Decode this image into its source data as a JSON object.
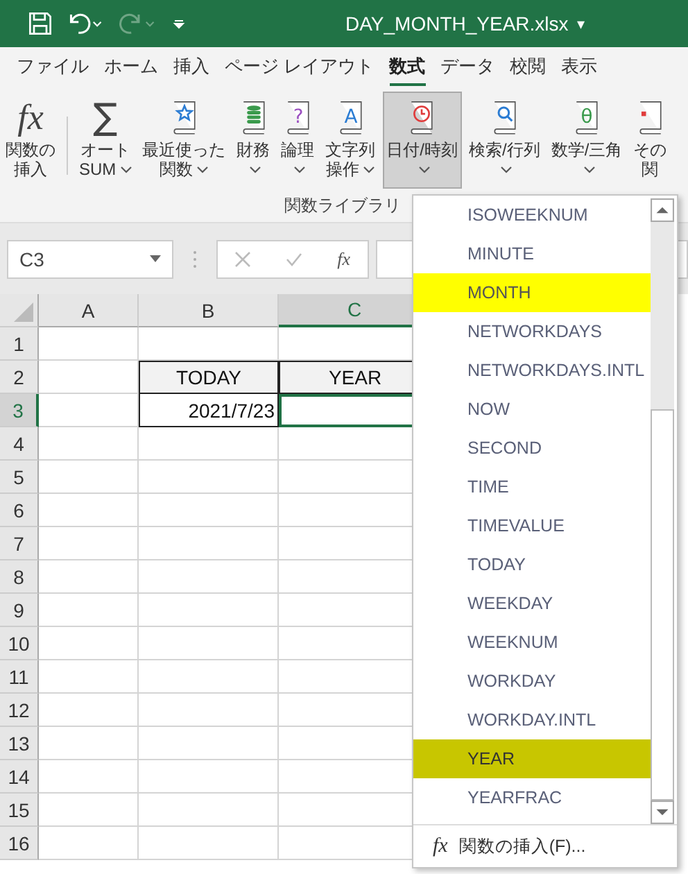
{
  "title_bar": {
    "filename": "DAY_MONTH_YEAR.xlsx",
    "caret": "▾"
  },
  "tabs": [
    {
      "label": "ファイル",
      "selected": false
    },
    {
      "label": "ホーム",
      "selected": false
    },
    {
      "label": "挿入",
      "selected": false
    },
    {
      "label": "ページ レイアウト",
      "selected": false
    },
    {
      "label": "数式",
      "selected": true
    },
    {
      "label": "データ",
      "selected": false
    },
    {
      "label": "校閲",
      "selected": false
    },
    {
      "label": "表示",
      "selected": false
    }
  ],
  "ribbon": {
    "buttons": [
      {
        "lines": [
          "関数の",
          "挿入"
        ],
        "dropdown": false,
        "pressed": false,
        "icon": {
          "kind": "glyph",
          "glyph": "fx"
        }
      },
      {
        "lines": [
          "オート",
          "SUM"
        ],
        "dropdown": true,
        "pressed": false,
        "icon": {
          "kind": "glyph",
          "glyph": "∑"
        }
      },
      {
        "lines": [
          "最近使った",
          "関数"
        ],
        "dropdown": true,
        "pressed": false,
        "icon": {
          "kind": "star",
          "color": "#2b7cd3"
        }
      },
      {
        "lines": [
          "財務"
        ],
        "dropdown": true,
        "pressed": false,
        "icon": {
          "kind": "database",
          "color": "#3a9a4c"
        }
      },
      {
        "lines": [
          "論理"
        ],
        "dropdown": true,
        "pressed": false,
        "icon": {
          "kind": "letter",
          "glyph": "?",
          "color": "#9b4fc0"
        }
      },
      {
        "lines": [
          "文字列",
          "操作"
        ],
        "dropdown": true,
        "pressed": false,
        "icon": {
          "kind": "letter",
          "glyph": "A",
          "color": "#2b7cd3"
        }
      },
      {
        "lines": [
          "日付/時刻"
        ],
        "dropdown": true,
        "pressed": true,
        "icon": {
          "kind": "clock",
          "color": "#e03c3c"
        }
      },
      {
        "lines": [
          "検索/行列"
        ],
        "dropdown": true,
        "pressed": false,
        "icon": {
          "kind": "search",
          "color": "#2b7cd3"
        }
      },
      {
        "lines": [
          "数学/三角"
        ],
        "dropdown": true,
        "pressed": false,
        "icon": {
          "kind": "letter",
          "glyph": "θ",
          "color": "#3a9a4c"
        }
      },
      {
        "lines": [
          "その",
          "関"
        ],
        "dropdown": false,
        "pressed": false,
        "icon": {
          "kind": "dot",
          "color": "#e03c3c"
        }
      }
    ],
    "group_label": "関数ライブラリ"
  },
  "formula_bar": {
    "name_box": "C3",
    "fx": "fx"
  },
  "sheet": {
    "columns": [
      {
        "label": "A",
        "selected": false
      },
      {
        "label": "B",
        "selected": false
      },
      {
        "label": "C",
        "selected": true
      }
    ],
    "rows": [
      {
        "label": "1",
        "selected": false
      },
      {
        "label": "2",
        "selected": false,
        "cells": [
          {
            "kind": "empty",
            "selected": false
          },
          {
            "kind": "header",
            "text": "TODAY",
            "selected": false
          },
          {
            "kind": "header",
            "text": "YEAR",
            "selected": false
          }
        ]
      },
      {
        "label": "3",
        "selected": true,
        "cells": [
          {
            "kind": "empty",
            "selected": false
          },
          {
            "kind": "value",
            "text": "2021/7/23",
            "selected": false
          },
          {
            "kind": "value",
            "selected": true
          }
        ]
      },
      {
        "label": "4",
        "selected": false
      },
      {
        "label": "5",
        "selected": false
      },
      {
        "label": "6",
        "selected": false
      },
      {
        "label": "7",
        "selected": false
      },
      {
        "label": "8",
        "selected": false
      },
      {
        "label": "9",
        "selected": false
      },
      {
        "label": "10",
        "selected": false
      },
      {
        "label": "11",
        "selected": false
      },
      {
        "label": "12",
        "selected": false
      },
      {
        "label": "13",
        "selected": false
      },
      {
        "label": "14",
        "selected": false
      },
      {
        "label": "15",
        "selected": false
      },
      {
        "label": "16",
        "selected": false
      }
    ]
  },
  "dropdown": {
    "items": [
      {
        "label": "ISOWEEKNUM",
        "selected": false,
        "highlighted": false
      },
      {
        "label": "MINUTE",
        "selected": false,
        "highlighted": false
      },
      {
        "label": "MONTH",
        "selected": false,
        "highlighted": true
      },
      {
        "label": "NETWORKDAYS",
        "selected": false,
        "highlighted": false
      },
      {
        "label": "NETWORKDAYS.INTL",
        "selected": false,
        "highlighted": false
      },
      {
        "label": "NOW",
        "selected": false,
        "highlighted": false
      },
      {
        "label": "SECOND",
        "selected": false,
        "highlighted": false
      },
      {
        "label": "TIME",
        "selected": false,
        "highlighted": false
      },
      {
        "label": "TIMEVALUE",
        "selected": false,
        "highlighted": false
      },
      {
        "label": "TODAY",
        "selected": false,
        "highlighted": false
      },
      {
        "label": "WEEKDAY",
        "selected": false,
        "highlighted": false
      },
      {
        "label": "WEEKNUM",
        "selected": false,
        "highlighted": false
      },
      {
        "label": "WORKDAY",
        "selected": false,
        "highlighted": false
      },
      {
        "label": "WORKDAY.INTL",
        "selected": false,
        "highlighted": false
      },
      {
        "label": "YEAR",
        "selected": true,
        "highlighted": false
      },
      {
        "label": "YEARFRAC",
        "selected": false,
        "highlighted": false
      }
    ],
    "footer": {
      "icon_glyph": "fx",
      "label": "関数の挿入(F)..."
    }
  }
}
